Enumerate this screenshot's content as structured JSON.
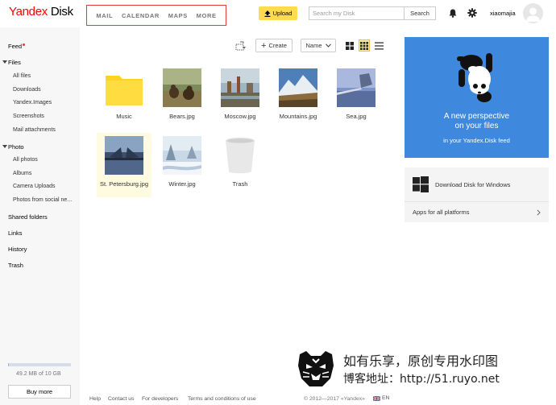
{
  "header": {
    "logo_brand": "Yandex",
    "logo_product": "Disk",
    "nav": [
      "MAIL",
      "CALENDAR",
      "MAPS",
      "MORE"
    ],
    "upload_label": "Upload",
    "search_placeholder": "Search my Disk",
    "search_button": "Search",
    "username": "xiaomajia",
    "icons": [
      "upload-icon",
      "bell-icon",
      "gear-icon",
      "avatar"
    ]
  },
  "sidebar": {
    "feed": "Feed",
    "files": "Files",
    "files_items": [
      "All files",
      "Downloads",
      "Yandex.Images",
      "Screenshots",
      "Mail attachments"
    ],
    "photo": "Photo",
    "photo_items": [
      "All photos",
      "Albums",
      "Camera Uploads",
      "Photos from social ne..."
    ],
    "shared": "Shared folders",
    "links": "Links",
    "history": "History",
    "trash": "Trash",
    "storage_text": "49.2 MB of 10 GB",
    "storage_fraction": 0.005,
    "buy_more": "Buy more"
  },
  "toolbar": {
    "create_label": "Create",
    "sort_label": "Name",
    "view_modes": [
      "large-tiles",
      "small-tiles",
      "list"
    ],
    "active_view": "small-tiles"
  },
  "files": [
    {
      "name": "Music",
      "kind": "folder"
    },
    {
      "name": "Bears.jpg",
      "kind": "image"
    },
    {
      "name": "Moscow.jpg",
      "kind": "image"
    },
    {
      "name": "Mountains.jpg",
      "kind": "image"
    },
    {
      "name": "Sea.jpg",
      "kind": "image"
    },
    {
      "name": "St. Petersburg.jpg",
      "kind": "image"
    },
    {
      "name": "Winter.jpg",
      "kind": "image"
    },
    {
      "name": "Trash",
      "kind": "trash"
    }
  ],
  "promo": {
    "title_line1": "A new perspective",
    "title_line2": "on your files",
    "subtitle": "in your Yandex.Disk feed",
    "bg_color": "#3e88de"
  },
  "download": {
    "label": "Download Disk for Windows",
    "apps_label": "Apps for all platforms"
  },
  "footer": {
    "links": [
      "Help",
      "Contact us",
      "For developers",
      "Terms and conditions of use"
    ],
    "copyright": "© 2012—2017 «Yandex»",
    "lang": "EN"
  },
  "watermark": {
    "line1": "如有乐享，原创专用水印图",
    "line2": "博客地址：http://51.ruyo.net"
  },
  "colors": {
    "accent": "#ffdb4d",
    "nav_border": "#e53935",
    "sidebar_bg": "#f7f7f7"
  }
}
